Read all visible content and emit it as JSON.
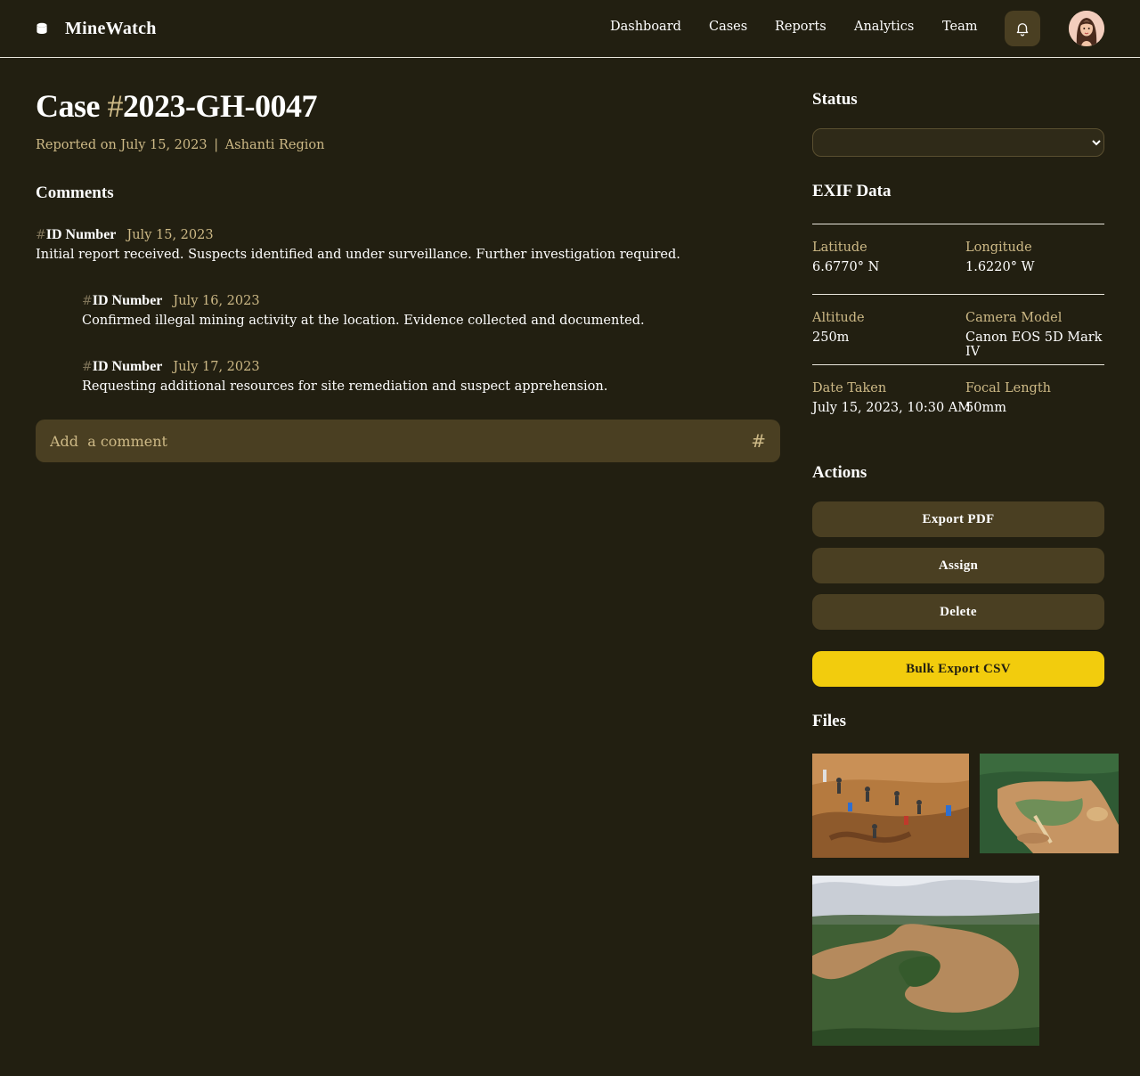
{
  "app": {
    "name": "MineWatch",
    "nav": [
      "Dashboard",
      "Cases",
      "Reports",
      "Analytics",
      "Team"
    ]
  },
  "case": {
    "title_prefix": "Case ",
    "title_hash": "#",
    "title_id": "2023-GH-0047",
    "reported_prefix": "Reported on",
    "reported_date": "July 15, 2023",
    "separator": "|",
    "region": "Ashanti Region"
  },
  "comments": {
    "heading": "Comments",
    "items": [
      {
        "hash": "#",
        "author": "ID Number",
        "date": "July 15, 2023",
        "text": "Initial report received. Suspects identified and under surveillance. Further investigation required."
      },
      {
        "hash": "#",
        "author": "ID Number",
        "date": "July 16, 2023",
        "text": "Confirmed illegal mining activity at the location. Evidence collected and documented."
      },
      {
        "hash": "#",
        "author": "ID Number",
        "date": "July 17, 2023",
        "text": "Requesting additional resources for site remediation and suspect apprehension."
      }
    ],
    "input_placeholder": "Add  a comment",
    "submit_glyph": "#"
  },
  "status": {
    "heading": "Status",
    "selected": ""
  },
  "exif": {
    "heading": "EXIF Data",
    "rows": [
      [
        {
          "label": "Latitude",
          "value": "6.6770° N"
        },
        {
          "label": "Longitude",
          "value": "1.6220° W"
        }
      ],
      [
        {
          "label": "Altitude",
          "value": "250m"
        },
        {
          "label": "Camera Model",
          "value": "Canon EOS 5D Mark IV"
        }
      ],
      [
        {
          "label": "Date Taken",
          "value": "July 15, 2023, 10:30 AM"
        },
        {
          "label": "Focal Length",
          "value": "50mm"
        }
      ]
    ]
  },
  "actions": {
    "heading": "Actions",
    "export_pdf": "Export PDF",
    "assign": "Assign",
    "delete": "Delete",
    "bulk_export": "Bulk Export CSV"
  },
  "files": {
    "heading": "Files"
  },
  "colors": {
    "background": "#221f11",
    "surface": "#4a3f22",
    "muted_text": "#cdb986",
    "accent": "#f2cc0d"
  }
}
